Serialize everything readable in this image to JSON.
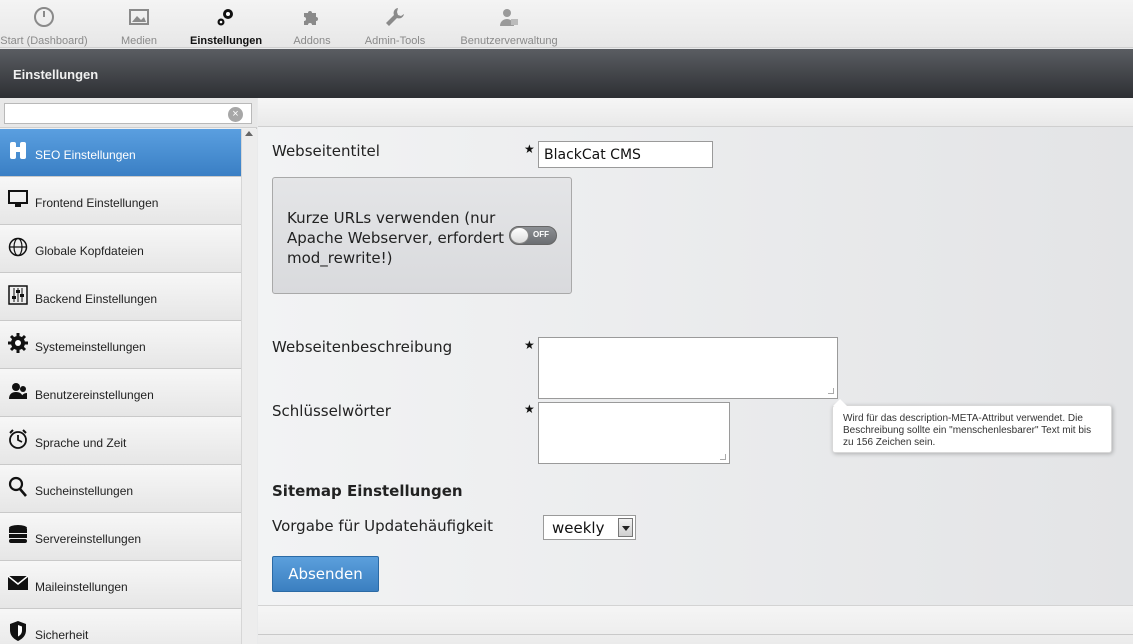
{
  "nav": {
    "items": [
      {
        "label": "Start (Dashboard)",
        "icon": "dashboard-gauge-icon"
      },
      {
        "label": "Medien",
        "icon": "media-image-icon"
      },
      {
        "label": "Einstellungen",
        "icon": "settings-gears-icon"
      },
      {
        "label": "Addons",
        "icon": "puzzle-icon"
      },
      {
        "label": "Admin-Tools",
        "icon": "wrench-icon"
      },
      {
        "label": "Benutzerverwaltung",
        "icon": "users-icon"
      }
    ]
  },
  "page": {
    "title": "Einstellungen"
  },
  "sidebar": {
    "search": {
      "value": "",
      "placeholder": ""
    },
    "items": [
      {
        "label": "SEO Einstellungen",
        "icon": "binoculars-icon"
      },
      {
        "label": "Frontend Einstellungen",
        "icon": "monitor-icon"
      },
      {
        "label": "Globale Kopfdateien",
        "icon": "globe-icon"
      },
      {
        "label": "Backend Einstellungen",
        "icon": "sliders-icon"
      },
      {
        "label": "Systemeinstellungen",
        "icon": "gear-icon"
      },
      {
        "label": "Benutzereinstellungen",
        "icon": "users-icon"
      },
      {
        "label": "Sprache und Zeit",
        "icon": "clock-icon"
      },
      {
        "label": "Sucheinstellungen",
        "icon": "search-icon"
      },
      {
        "label": "Servereinstellungen",
        "icon": "database-icon"
      },
      {
        "label": "Maileinstellungen",
        "icon": "mail-icon"
      },
      {
        "label": "Sicherheit",
        "icon": "shield-icon"
      }
    ]
  },
  "form": {
    "title_label": "Webseitentitel",
    "title_value": "BlackCat CMS",
    "short_urls_label": "Kurze URLs verwenden (nur Apache Webserver, erfordert mod_rewrite!)",
    "short_urls_state": "OFF",
    "description_label": "Webseitenbeschreibung",
    "description_value": "",
    "keywords_label": "Schlüsselwörter",
    "keywords_value": "",
    "tooltip": "Wird für das description-META-Attribut verwendet. Die Beschreibung sollte ein \"menschenlesbarer\" Text mit bis zu 156 Zeichen sein.",
    "required_mark": "★",
    "sitemap_title": "Sitemap Einstellungen",
    "update_label": "Vorgabe für Updatehäufigkeit",
    "update_value": "weekly",
    "submit_label": "Absenden"
  },
  "colors": {
    "accent": "#3b7fc0",
    "titlebar": "#3a3c40",
    "active_item": "#4a8fd3"
  }
}
